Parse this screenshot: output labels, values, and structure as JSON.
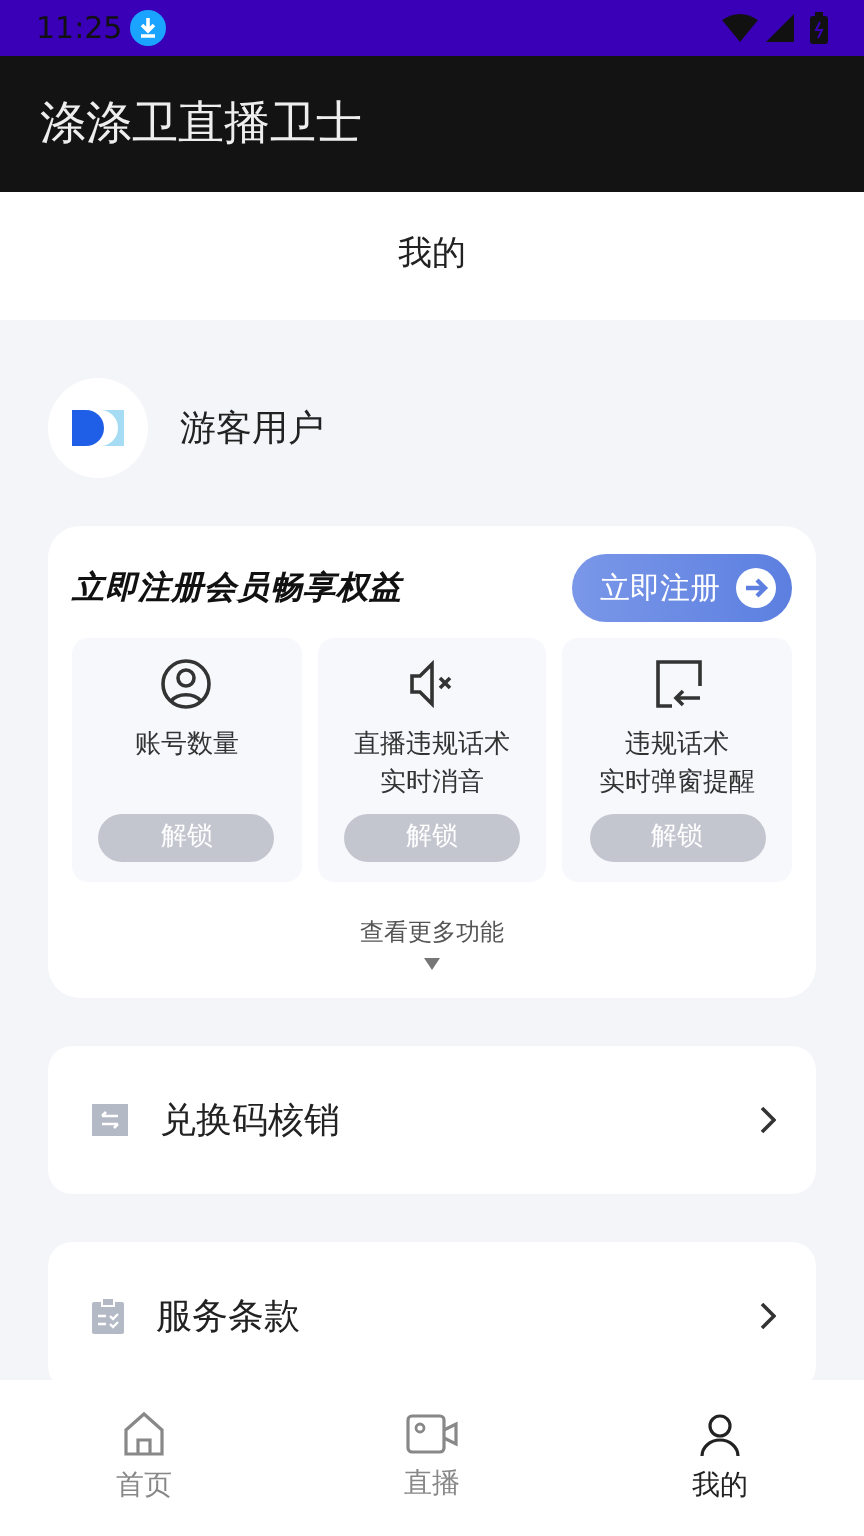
{
  "status_bar": {
    "time": "11:25"
  },
  "app_bar": {
    "title": "涤涤卫直播卫士"
  },
  "header": {
    "title": "我的"
  },
  "profile": {
    "name": "游客用户"
  },
  "promo": {
    "title": "立即注册会员畅享权益",
    "button": "立即注册",
    "features": [
      {
        "lines": [
          "账号数量"
        ],
        "action": "解锁"
      },
      {
        "lines": [
          "直播违规话术",
          "实时消音"
        ],
        "action": "解锁"
      },
      {
        "lines": [
          "违规话术",
          "实时弹窗提醒"
        ],
        "action": "解锁"
      }
    ],
    "more": "查看更多功能"
  },
  "menu": [
    {
      "label": "兑换码核销"
    },
    {
      "label": "服务条款"
    }
  ],
  "tabs": [
    {
      "label": "首页",
      "selected": false
    },
    {
      "label": "直播",
      "selected": false
    },
    {
      "label": "我的",
      "selected": true
    }
  ]
}
